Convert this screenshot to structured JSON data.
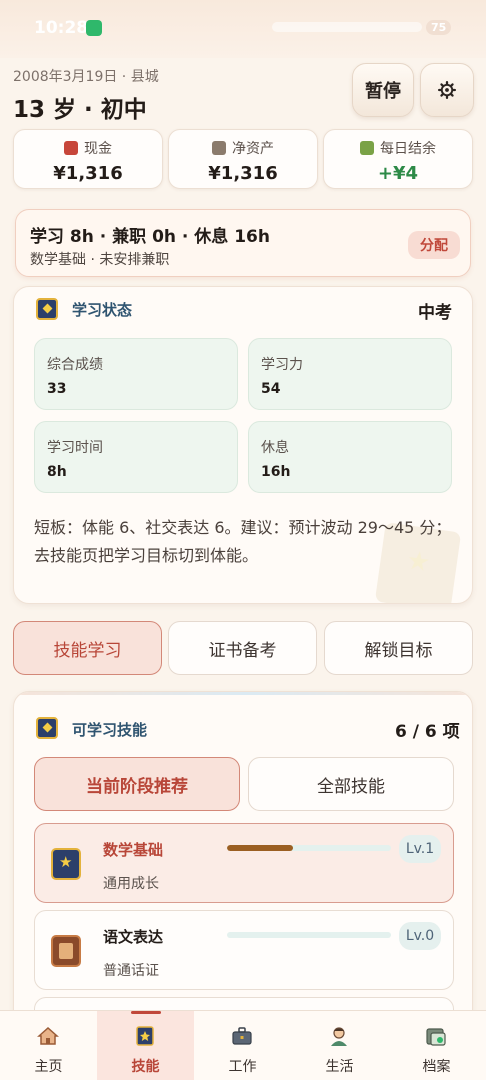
{
  "status_bar": {
    "time": "10:28",
    "battery": "75"
  },
  "header": {
    "date_line": "2008年3月19日 · 县城",
    "title": "13 岁 · 初中",
    "pause_label": "暂停"
  },
  "stats": [
    {
      "label": "现金",
      "value": "¥1,316",
      "icon": "red-envelope-icon"
    },
    {
      "label": "净资产",
      "value": "¥1,316",
      "icon": "bank-icon"
    },
    {
      "label": "每日结余",
      "value": "+¥4",
      "icon": "sprout-icon"
    }
  ],
  "schedule": {
    "main": "学习 8h · 兼职 0h · 休息 16h",
    "sub": "数学基础 · 未安排兼职",
    "button": "分配"
  },
  "study_status": {
    "title": "学习状态",
    "stage": "中考",
    "metrics": [
      {
        "label": "综合成绩",
        "value": "33"
      },
      {
        "label": "学习力",
        "value": "54"
      },
      {
        "label": "学习时间",
        "value": "8h"
      },
      {
        "label": "休息",
        "value": "16h"
      }
    ],
    "note": "短板：体能 6、社交表达 6。建议：预计波动 29～45 分；去技能页把学习目标切到体能。"
  },
  "tabs": [
    "技能学习",
    "证书备考",
    "解锁目标"
  ],
  "skills": {
    "title": "可学习技能",
    "count": "6 / 6 项",
    "filters": [
      "当前阶段推荐",
      "全部技能"
    ],
    "items": [
      {
        "name": "数学基础",
        "desc": "通用成长",
        "level": "Lv.1",
        "progress": 0.4
      },
      {
        "name": "语文表达",
        "desc": "普通话证",
        "level": "Lv.0",
        "progress": 0.0
      }
    ]
  },
  "nav": [
    {
      "label": "主页",
      "icon": "home-icon"
    },
    {
      "label": "技能",
      "icon": "book-icon"
    },
    {
      "label": "工作",
      "icon": "briefcase-icon"
    },
    {
      "label": "生活",
      "icon": "person-icon"
    },
    {
      "label": "档案",
      "icon": "file-icon"
    }
  ],
  "colors": {
    "accent": "#c0483a",
    "positive": "#2d8a47",
    "section_title": "#2f5470",
    "background": "#fbf4ec"
  }
}
